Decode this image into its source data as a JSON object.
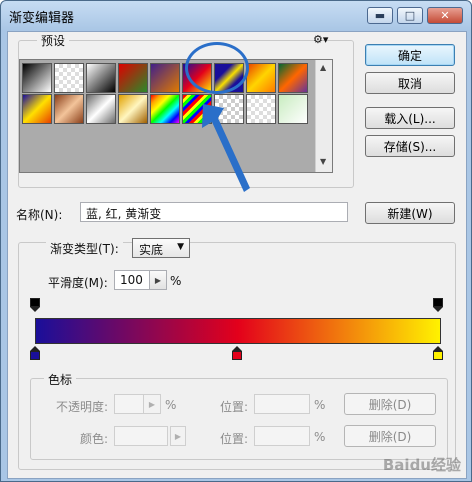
{
  "window": {
    "title": "渐变编辑器",
    "min_label": "▬",
    "max_label": "□",
    "close_label": "✕"
  },
  "presets": {
    "label": "预设",
    "gear_glyph": "⚙▾",
    "scroll_up": "▲",
    "scroll_down": "▼"
  },
  "actions": {
    "ok": "确定",
    "cancel": "取消",
    "load": "载入(L)...",
    "save": "存储(S)..."
  },
  "name": {
    "label": "名称(N):",
    "value": "蓝, 红, 黄渐变",
    "new_button": "新建(W)"
  },
  "gradient": {
    "type_label": "渐变类型(T):",
    "type_value": "实底",
    "smooth_label": "平滑度(M):",
    "smooth_value": "100",
    "smooth_unit": "%",
    "colors": [
      "#1a0f9a",
      "#e3001b",
      "#fff200"
    ],
    "color_stops": [
      0,
      50,
      100
    ],
    "opacity_stops": [
      0,
      100
    ]
  },
  "stops": {
    "group_label": "色标",
    "opacity_label": "不透明度:",
    "opacity_unit": "%",
    "location_label": "位置:",
    "location_unit": "%",
    "delete_label": "删除(D)",
    "color_label": "颜色:",
    "location_label_2": "位置:",
    "location_unit_2": "%",
    "delete_label_2": "删除(D)"
  },
  "watermark": "Baidu经验"
}
